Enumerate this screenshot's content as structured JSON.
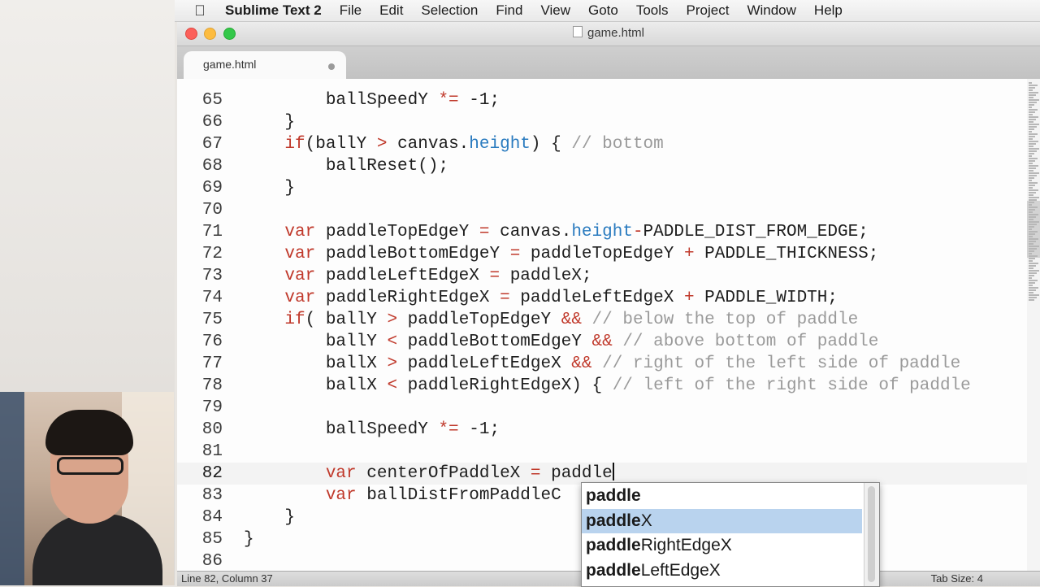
{
  "menubar": {
    "app_name": "Sublime Text 2",
    "items": [
      "File",
      "Edit",
      "Selection",
      "Find",
      "View",
      "Goto",
      "Tools",
      "Project",
      "Window",
      "Help"
    ]
  },
  "window": {
    "title": "game.html"
  },
  "tab": {
    "label": "game.html"
  },
  "status": {
    "position": "Line 82, Column 37",
    "tab_size": "Tab Size: 4"
  },
  "colors": {
    "keyword": "#c0392b",
    "property": "#2a7bbf",
    "comment": "#9a9a9a",
    "selection": "#b9d3ee"
  },
  "code_lines": [
    {
      "num": "65",
      "tokens": [
        {
          "t": "        ballSpeedY "
        },
        {
          "t": "*=",
          "c": "op"
        },
        {
          "t": " -1;"
        }
      ]
    },
    {
      "num": "66",
      "tokens": [
        {
          "t": "    }"
        }
      ]
    },
    {
      "num": "67",
      "tokens": [
        {
          "t": "    "
        },
        {
          "t": "if",
          "c": "kw"
        },
        {
          "t": "(ballY "
        },
        {
          "t": ">",
          "c": "op"
        },
        {
          "t": " canvas."
        },
        {
          "t": "height",
          "c": "prop"
        },
        {
          "t": ") { "
        },
        {
          "t": "// bottom",
          "c": "cm"
        }
      ]
    },
    {
      "num": "68",
      "tokens": [
        {
          "t": "        ballReset();"
        }
      ]
    },
    {
      "num": "69",
      "tokens": [
        {
          "t": "    }"
        }
      ]
    },
    {
      "num": "70",
      "tokens": [
        {
          "t": ""
        }
      ]
    },
    {
      "num": "71",
      "tokens": [
        {
          "t": "    "
        },
        {
          "t": "var",
          "c": "kw"
        },
        {
          "t": " paddleTopEdgeY "
        },
        {
          "t": "=",
          "c": "op"
        },
        {
          "t": " canvas."
        },
        {
          "t": "height",
          "c": "prop"
        },
        {
          "t": "-",
          "c": "op"
        },
        {
          "t": "PADDLE_DIST_FROM_EDGE;"
        }
      ]
    },
    {
      "num": "72",
      "tokens": [
        {
          "t": "    "
        },
        {
          "t": "var",
          "c": "kw"
        },
        {
          "t": " paddleBottomEdgeY "
        },
        {
          "t": "=",
          "c": "op"
        },
        {
          "t": " paddleTopEdgeY "
        },
        {
          "t": "+",
          "c": "op"
        },
        {
          "t": " PADDLE_THICKNESS;"
        }
      ]
    },
    {
      "num": "73",
      "tokens": [
        {
          "t": "    "
        },
        {
          "t": "var",
          "c": "kw"
        },
        {
          "t": " paddleLeftEdgeX "
        },
        {
          "t": "=",
          "c": "op"
        },
        {
          "t": " paddleX;"
        }
      ]
    },
    {
      "num": "74",
      "tokens": [
        {
          "t": "    "
        },
        {
          "t": "var",
          "c": "kw"
        },
        {
          "t": " paddleRightEdgeX "
        },
        {
          "t": "=",
          "c": "op"
        },
        {
          "t": " paddleLeftEdgeX "
        },
        {
          "t": "+",
          "c": "op"
        },
        {
          "t": " PADDLE_WIDTH;"
        }
      ]
    },
    {
      "num": "75",
      "tokens": [
        {
          "t": "    "
        },
        {
          "t": "if",
          "c": "kw"
        },
        {
          "t": "( ballY "
        },
        {
          "t": ">",
          "c": "op"
        },
        {
          "t": " paddleTopEdgeY "
        },
        {
          "t": "&&",
          "c": "op"
        },
        {
          "t": " "
        },
        {
          "t": "// below the top of paddle",
          "c": "cm"
        }
      ]
    },
    {
      "num": "76",
      "tokens": [
        {
          "t": "        ballY "
        },
        {
          "t": "<",
          "c": "op"
        },
        {
          "t": " paddleBottomEdgeY "
        },
        {
          "t": "&&",
          "c": "op"
        },
        {
          "t": " "
        },
        {
          "t": "// above bottom of paddle",
          "c": "cm"
        }
      ]
    },
    {
      "num": "77",
      "tokens": [
        {
          "t": "        ballX "
        },
        {
          "t": ">",
          "c": "op"
        },
        {
          "t": " paddleLeftEdgeX "
        },
        {
          "t": "&&",
          "c": "op"
        },
        {
          "t": " "
        },
        {
          "t": "// right of the left side of paddle",
          "c": "cm"
        }
      ]
    },
    {
      "num": "78",
      "tokens": [
        {
          "t": "        ballX "
        },
        {
          "t": "<",
          "c": "op"
        },
        {
          "t": " paddleRightEdgeX) { "
        },
        {
          "t": "// left of the right side of paddle",
          "c": "cm"
        }
      ]
    },
    {
      "num": "79",
      "tokens": [
        {
          "t": ""
        }
      ]
    },
    {
      "num": "80",
      "tokens": [
        {
          "t": "        ballSpeedY "
        },
        {
          "t": "*=",
          "c": "op"
        },
        {
          "t": " -1;"
        }
      ]
    },
    {
      "num": "81",
      "tokens": [
        {
          "t": ""
        }
      ]
    },
    {
      "num": "82",
      "current": true,
      "tokens": [
        {
          "t": "        "
        },
        {
          "t": "var",
          "c": "kw"
        },
        {
          "t": " centerOfPaddleX "
        },
        {
          "t": "=",
          "c": "op"
        },
        {
          "t": " paddle"
        }
      ]
    },
    {
      "num": "83",
      "tokens": [
        {
          "t": "        "
        },
        {
          "t": "var",
          "c": "kw"
        },
        {
          "t": " ballDistFromPaddleC"
        }
      ]
    },
    {
      "num": "84",
      "tokens": [
        {
          "t": "    }"
        }
      ]
    },
    {
      "num": "85",
      "tokens": [
        {
          "t": "}"
        }
      ]
    },
    {
      "num": "86",
      "tokens": [
        {
          "t": ""
        }
      ]
    }
  ],
  "autocomplete": {
    "typed": "paddle",
    "items": [
      {
        "match": "paddle",
        "rest": ""
      },
      {
        "match": "paddle",
        "rest": "X",
        "selected": true
      },
      {
        "match": "paddle",
        "rest": "RightEdgeX"
      },
      {
        "match": "paddle",
        "rest": "LeftEdgeX"
      }
    ]
  }
}
